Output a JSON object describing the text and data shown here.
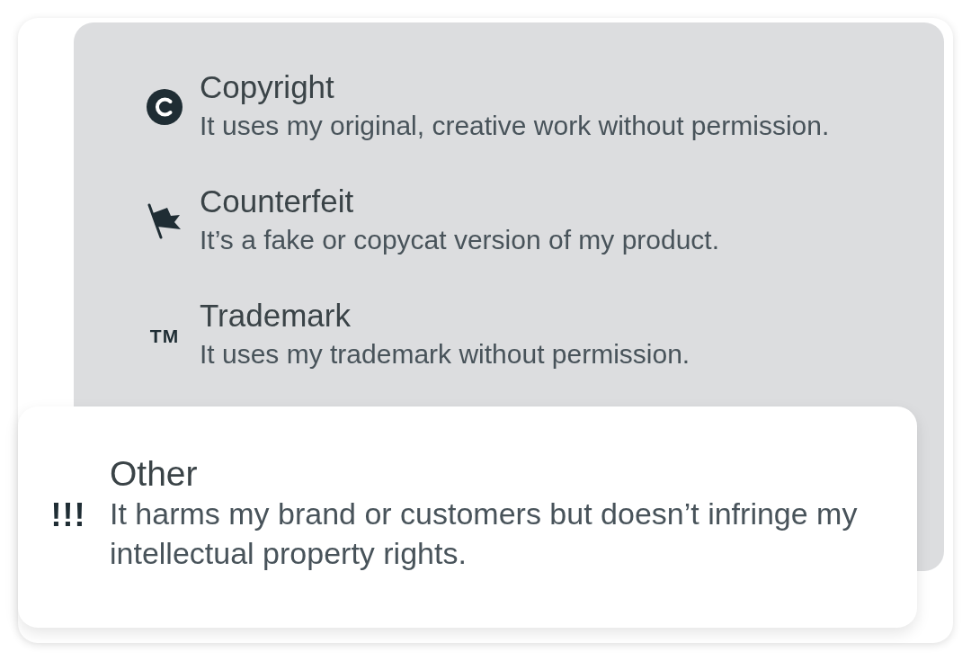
{
  "options": [
    {
      "kind": "copyright",
      "title": "Copyright",
      "description": "It uses my original, creative work without permission.",
      "selected": false
    },
    {
      "kind": "flag",
      "title": "Counterfeit",
      "description": "It’s a fake or copycat version of my product.",
      "selected": false
    },
    {
      "kind": "trademark",
      "glyph": "TM",
      "title": "Trademark",
      "description": "It uses my trademark without permission.",
      "selected": false
    },
    {
      "kind": "alert",
      "glyph": "!!!",
      "title": "Other",
      "description": "It harms my brand or customers but doesn’t infringe my intellectual property rights.",
      "selected": true
    }
  ]
}
